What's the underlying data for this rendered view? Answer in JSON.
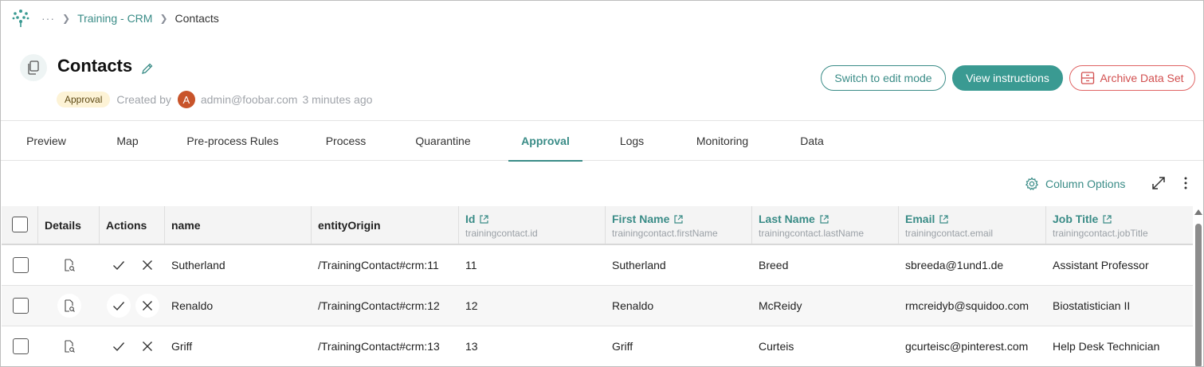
{
  "breadcrumb": {
    "ellipsis": "···",
    "items": [
      {
        "label": "Training - CRM"
      },
      {
        "label": "Contacts"
      }
    ]
  },
  "header": {
    "title": "Contacts",
    "status_badge": "Approval",
    "created_by_label": "Created by",
    "avatar_initial": "A",
    "creator_email": "admin@foobar.com",
    "created_time": "3 minutes ago"
  },
  "actions": {
    "switch_edit": "Switch to edit mode",
    "view_instructions": "View instructions",
    "archive": "Archive Data Set"
  },
  "tabs": [
    {
      "label": "Preview"
    },
    {
      "label": "Map"
    },
    {
      "label": "Pre-process Rules"
    },
    {
      "label": "Process"
    },
    {
      "label": "Quarantine"
    },
    {
      "label": "Approval"
    },
    {
      "label": "Logs"
    },
    {
      "label": "Monitoring"
    },
    {
      "label": "Data"
    }
  ],
  "active_tab": "Approval",
  "toolbar": {
    "column_options": "Column Options"
  },
  "table": {
    "columns": [
      {
        "title": "Details"
      },
      {
        "title": "Actions"
      },
      {
        "title": "name"
      },
      {
        "title": "entityOrigin"
      },
      {
        "title": "Id",
        "sub": "trainingcontact.id"
      },
      {
        "title": "First Name",
        "sub": "trainingcontact.firstName"
      },
      {
        "title": "Last Name",
        "sub": "trainingcontact.lastName"
      },
      {
        "title": "Email",
        "sub": "trainingcontact.email"
      },
      {
        "title": "Job Title",
        "sub": "trainingcontact.jobTitle"
      }
    ],
    "rows": [
      {
        "name": "Sutherland",
        "origin": "/TrainingContact#crm:11",
        "id": "11",
        "first": "Sutherland",
        "last": "Breed",
        "email": "sbreeda@1und1.de",
        "job": "Assistant Professor"
      },
      {
        "name": "Renaldo",
        "origin": "/TrainingContact#crm:12",
        "id": "12",
        "first": "Renaldo",
        "last": "McReidy",
        "email": "rmcreidyb@squidoo.com",
        "job": "Biostatistician II"
      },
      {
        "name": "Griff",
        "origin": "/TrainingContact#crm:13",
        "id": "13",
        "first": "Griff",
        "last": "Curteis",
        "email": "gcurteisc@pinterest.com",
        "job": "Help Desk Technician"
      }
    ]
  },
  "colors": {
    "accent": "#3a8c87",
    "primary_button": "#3a9a92",
    "danger": "#d24f4f",
    "badge_bg": "#fdf3d6",
    "avatar": "#c8542a"
  }
}
